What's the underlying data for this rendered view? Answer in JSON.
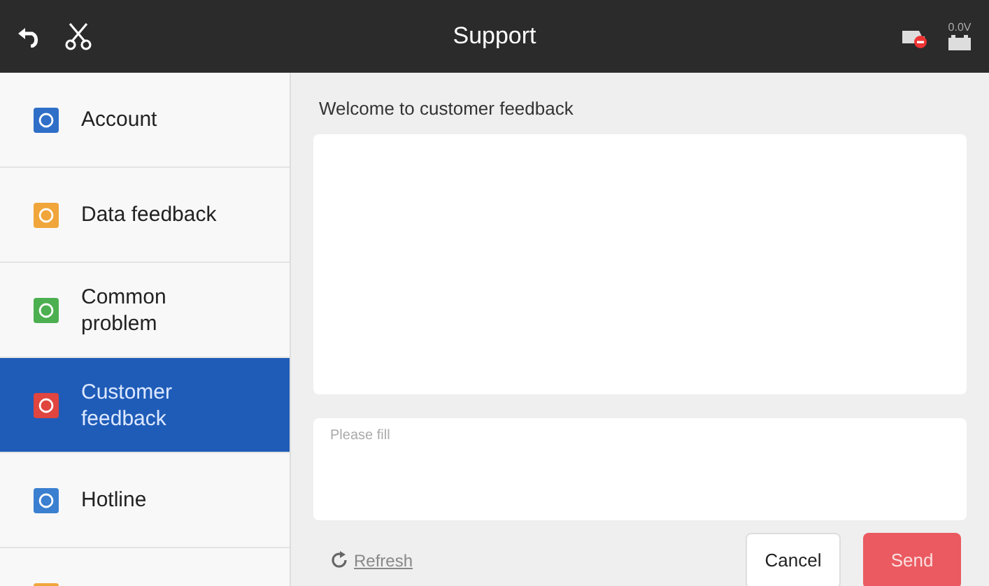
{
  "top_bar": {
    "title": "Support",
    "voltage": "0.0V"
  },
  "sidebar": {
    "items": [
      {
        "label": "Account",
        "color": "#2f6fc8",
        "selected": false
      },
      {
        "label": "Data feedback",
        "color": "#f0a63a",
        "selected": false
      },
      {
        "label": "Common problem",
        "color": "#4caf50",
        "selected": false
      },
      {
        "label": "Customer feedback",
        "color": "#e0453f",
        "selected": true
      },
      {
        "label": "Hotline",
        "color": "#3a7fd0",
        "selected": false
      },
      {
        "color": "#f0a63a",
        "selected": false
      }
    ]
  },
  "main": {
    "heading": "Welcome to customer feedback",
    "input": {
      "placeholder": "Please fill"
    },
    "refresh": "Refresh",
    "buttons": [
      {
        "kind": "cancel",
        "label": "Cancel"
      },
      {
        "kind": "send",
        "label": "Send"
      }
    ]
  }
}
